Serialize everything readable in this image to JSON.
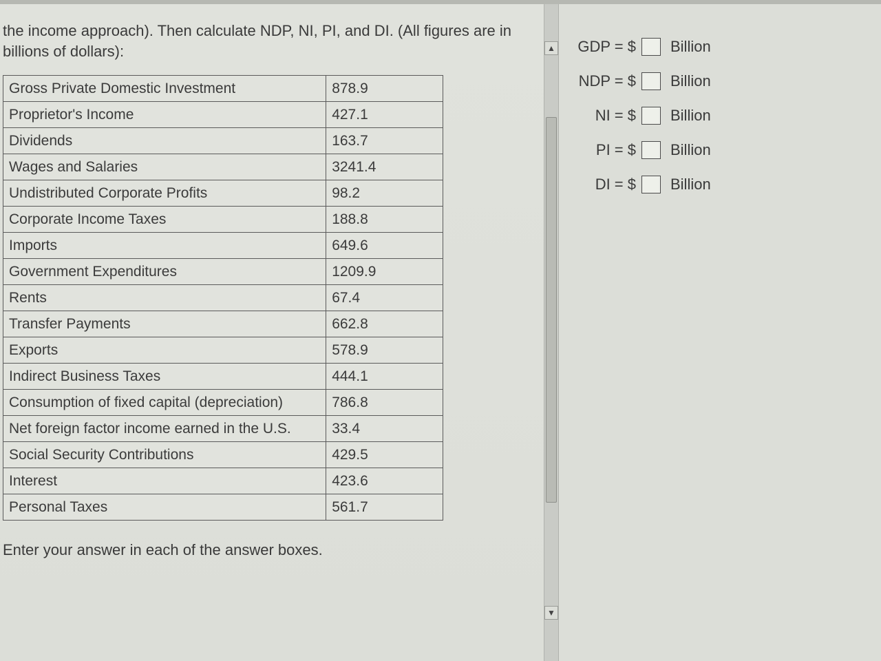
{
  "prompt": "the income approach). Then calculate NDP, NI, PI, and DI. (All figures are in billions of dollars):",
  "table_rows": [
    {
      "label": "Gross Private Domestic Investment",
      "value": "878.9"
    },
    {
      "label": "Proprietor's Income",
      "value": "427.1"
    },
    {
      "label": "Dividends",
      "value": "163.7"
    },
    {
      "label": "Wages and Salaries",
      "value": "3241.4"
    },
    {
      "label": "Undistributed Corporate Profits",
      "value": "98.2"
    },
    {
      "label": "Corporate Income Taxes",
      "value": "188.8"
    },
    {
      "label": "Imports",
      "value": "649.6"
    },
    {
      "label": "Government Expenditures",
      "value": "1209.9"
    },
    {
      "label": "Rents",
      "value": "67.4"
    },
    {
      "label": "Transfer Payments",
      "value": "662.8"
    },
    {
      "label": "Exports",
      "value": "578.9"
    },
    {
      "label": "Indirect Business Taxes",
      "value": "444.1"
    },
    {
      "label": "Consumption of fixed capital (depreciation)",
      "value": "786.8"
    },
    {
      "label": "Net foreign factor income earned in the U.S.",
      "value": "33.4"
    },
    {
      "label": "Social Security Contributions",
      "value": "429.5"
    },
    {
      "label": "Interest",
      "value": "423.6"
    },
    {
      "label": "Personal Taxes",
      "value": "561.7"
    }
  ],
  "footer": "Enter your answer in each of the answer boxes.",
  "answers": [
    {
      "label": "GDP = $",
      "unit": "Billion"
    },
    {
      "label": "NDP = $",
      "unit": "Billion"
    },
    {
      "label": "NI = $",
      "unit": "Billion"
    },
    {
      "label": "PI = $",
      "unit": "Billion"
    },
    {
      "label": "DI = $",
      "unit": "Billion"
    }
  ],
  "scroll": {
    "up_glyph": "▲",
    "down_glyph": "▼"
  }
}
